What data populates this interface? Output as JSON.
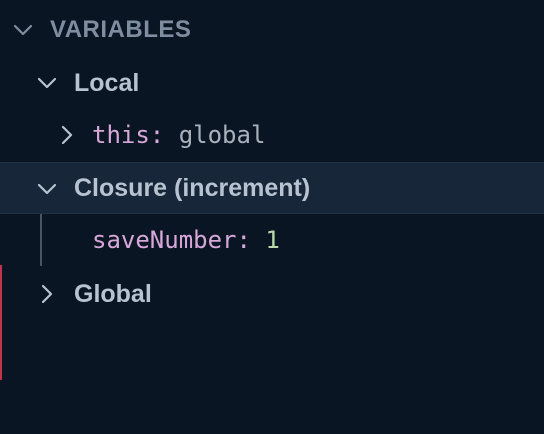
{
  "variables_panel": {
    "header": {
      "label": "VARIABLES",
      "icon": "chevron-down-icon"
    },
    "scopes": [
      {
        "label": "Local",
        "expanded": true,
        "icon": "chevron-down-icon",
        "entries": [
          {
            "name": "this",
            "separator": ":",
            "value": "global",
            "expandable": true,
            "icon": "chevron-right-icon"
          }
        ]
      },
      {
        "label": "Closure (increment)",
        "expanded": true,
        "selected": true,
        "icon": "chevron-down-icon",
        "entries": [
          {
            "name": "saveNumber",
            "separator": ":",
            "value": "1",
            "expandable": false
          }
        ]
      },
      {
        "label": "Global",
        "expanded": false,
        "icon": "chevron-right-icon"
      }
    ]
  },
  "colors": {
    "background": "#0a1524",
    "selected_row": "#172638",
    "header_text": "#7f8da0",
    "scope_text": "#b7c3d0",
    "variable_name": "#d7a7d9",
    "object_value": "#a8b1bb",
    "number_value": "#b7d9a8",
    "edge_marker": "#c2344a"
  }
}
